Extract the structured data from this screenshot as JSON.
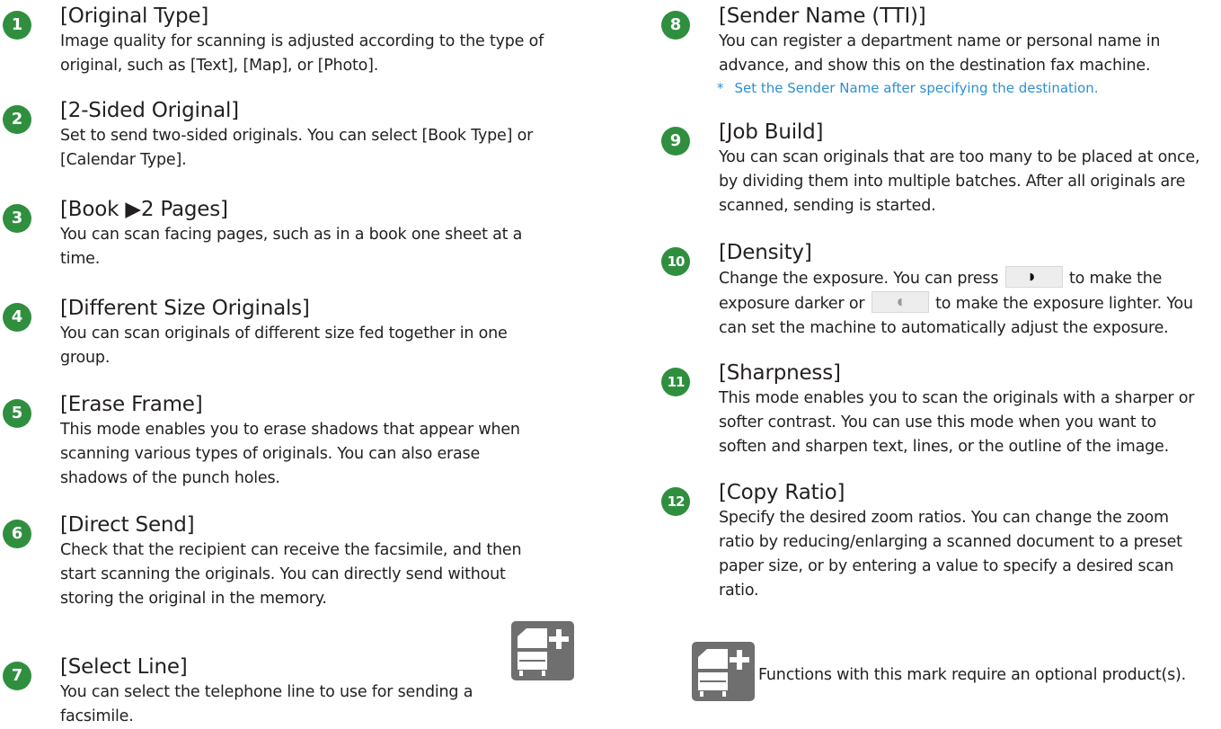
{
  "items": [
    {
      "num": "1",
      "title": "[Original Type]",
      "desc": "Image quality for scanning is adjusted according to the type of original, such as [Text], [Map], or [Photo]."
    },
    {
      "num": "2",
      "title": "[2-Sided Original]",
      "desc": "Set to send two-sided originals. You can select [Book Type] or [Calendar Type]."
    },
    {
      "num": "3",
      "title": "[Book ▶2 Pages]",
      "desc": "You can scan facing pages, such as in a book one sheet at a time."
    },
    {
      "num": "4",
      "title": "[Different Size Originals]",
      "desc": "You can scan originals of different size fed together in one group."
    },
    {
      "num": "5",
      "title": "[Erase Frame]",
      "desc": "This mode enables you to erase shadows that appear when scanning various types of originals. You can also erase shadows of the punch holes."
    },
    {
      "num": "6",
      "title": "[Direct Send]",
      "desc": "Check that the recipient can receive the facsimile, and then start scanning the originals. You can directly send without storing the original in the memory."
    },
    {
      "num": "7",
      "title": "[Select Line]",
      "desc": "You can select the telephone line to use for sending a facsimile."
    },
    {
      "num": "8",
      "title": "[Sender Name (TTI)]",
      "desc": "You can register a department name or personal name in advance, and show this on the destination fax machine.",
      "note_mark": "*",
      "note": "Set the Sender Name after specifying the destination."
    },
    {
      "num": "9",
      "title": "[Job Build]",
      "desc": "You can scan originals that are too many to be placed at once, by dividing them into multiple batches. After all originals are scanned, sending is started."
    },
    {
      "num": "10",
      "title": "[Density]",
      "desc_part1": "Change the exposure. You can press",
      "desc_part2": "to make the exposure darker or",
      "desc_part3": "to make the exposure lighter. You can set the machine to automatically adjust the exposure."
    },
    {
      "num": "11",
      "title": "[Sharpness]",
      "desc": "This mode enables you to scan the originals with a sharper or softer contrast. You can use this mode when you want to soften and sharpen text, lines, or the outline of the image."
    },
    {
      "num": "12",
      "title": "[Copy Ratio]",
      "desc": "Specify the desired zoom ratios. You can change the zoom ratio by reducing/enlarging a scanned document to a preset paper size, or by entering a value to specify a desired scan ratio."
    }
  ],
  "legend": {
    "text": "Functions with this mark require an optional product(s).",
    "icon": "optional-product-icon"
  },
  "colors": {
    "number_badge": "#2f8f3f",
    "note": "#2e8fd3",
    "icon_bg": "#6f6f6f"
  }
}
